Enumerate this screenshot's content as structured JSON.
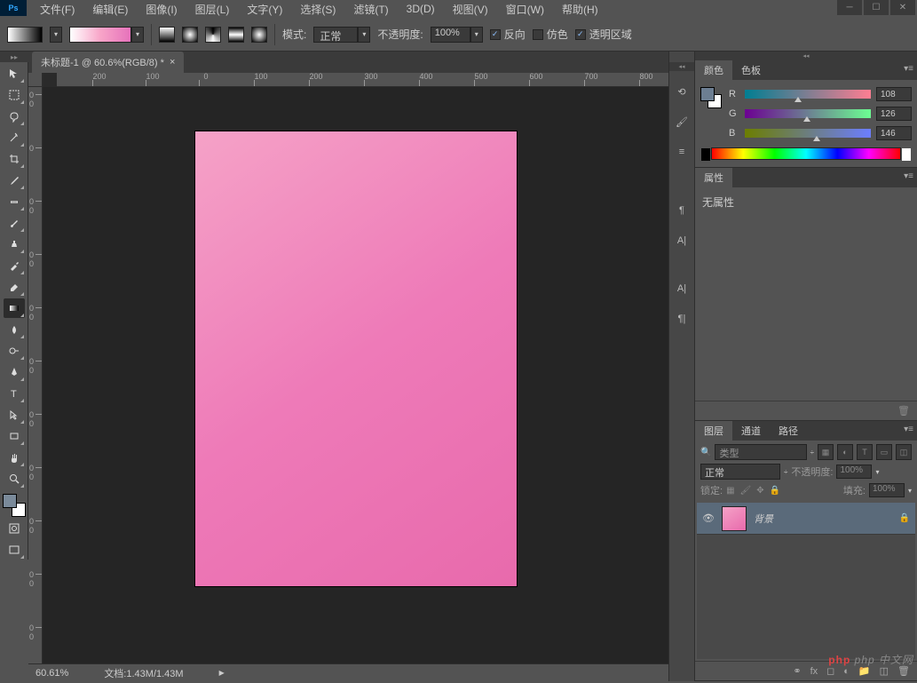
{
  "app": {
    "name": "Ps"
  },
  "menu": [
    "文件(F)",
    "编辑(E)",
    "图像(I)",
    "图层(L)",
    "文字(Y)",
    "选择(S)",
    "滤镜(T)",
    "3D(D)",
    "视图(V)",
    "窗口(W)",
    "帮助(H)"
  ],
  "options": {
    "mode_label": "模式:",
    "mode_value": "正常",
    "opacity_label": "不透明度:",
    "opacity_value": "100%",
    "reverse_label": "反向",
    "dither_label": "仿色",
    "transparency_label": "透明区域"
  },
  "doc_tab": {
    "title": "未标题-1 @ 60.6%(RGB/8) *"
  },
  "ruler_h": [
    "200",
    "100",
    "0",
    "100",
    "200",
    "300",
    "400",
    "500",
    "600",
    "700",
    "800"
  ],
  "ruler_v": [
    "1 0 0",
    "0",
    "1 0 0",
    "2 0 0",
    "3 0 0",
    "4 0 0",
    "5 0 0",
    "6 0 0",
    "7 0 0",
    "8 0 0",
    "9 0 0"
  ],
  "status": {
    "zoom": "60.61%",
    "doc": "文档:1.43M/1.43M"
  },
  "panels": {
    "color_tab": "颜色",
    "swatches_tab": "色板",
    "r_label": "R",
    "r_value": "108",
    "g_label": "G",
    "g_value": "126",
    "b_label": "B",
    "b_value": "146",
    "properties_tab": "属性",
    "no_properties": "无属性",
    "layers_tab": "图层",
    "channels_tab": "通道",
    "paths_tab": "路径",
    "kind_label": "类型",
    "blend_mode": "正常",
    "opacity_label": "不透明度:",
    "opacity_value": "100%",
    "lock_label": "锁定:",
    "fill_label": "填充:",
    "fill_value": "100%",
    "layer_name": "背景"
  },
  "watermark": "php 中文网"
}
